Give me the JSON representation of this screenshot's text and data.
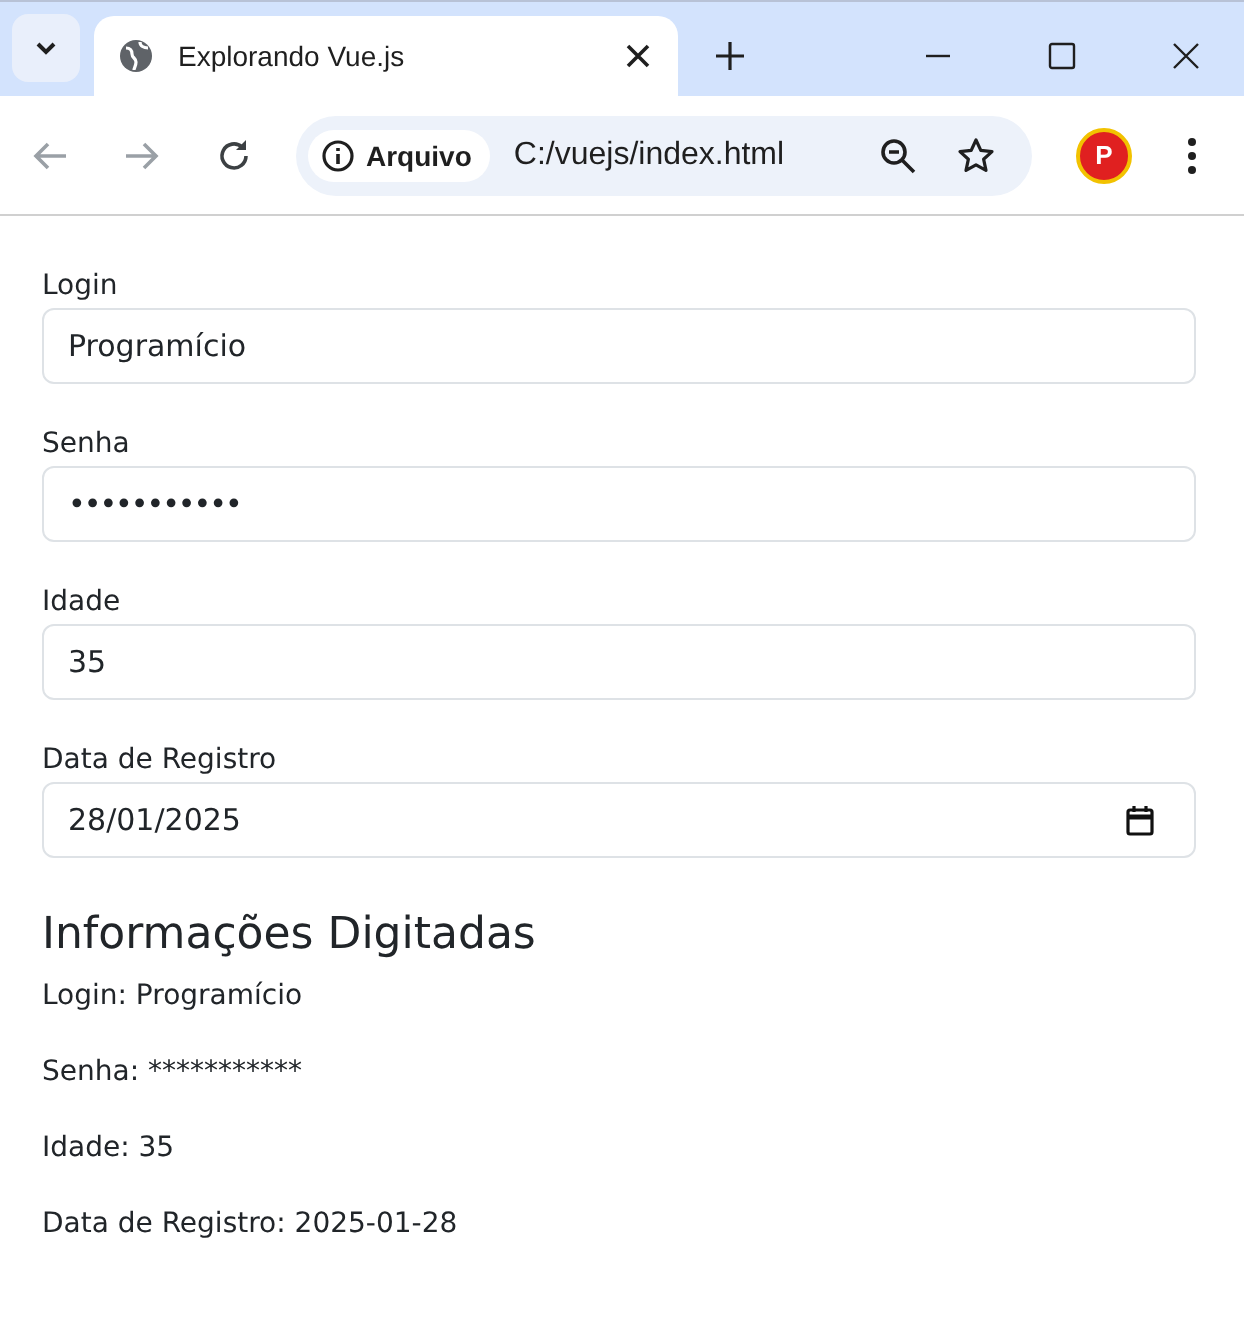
{
  "browser": {
    "tab_title": "Explorando Vue.js",
    "security_label": "Arquivo",
    "url": "C:/vuejs/index.html",
    "profile_letter": "P"
  },
  "fields": [
    {
      "label": "Login",
      "value": "Programício",
      "kind": "text"
    },
    {
      "label": "Senha",
      "value": "•••••••••••",
      "kind": "password"
    },
    {
      "label": "Idade",
      "value": "35",
      "kind": "number"
    },
    {
      "label": "Data de Registro",
      "value": "28/01/2025",
      "kind": "date"
    }
  ],
  "summary": {
    "heading": "Informações Digitadas",
    "lines": [
      "Login: Programício",
      "Senha: ***********",
      "Idade: 35",
      "Data de Registro: 2025-01-28"
    ]
  }
}
